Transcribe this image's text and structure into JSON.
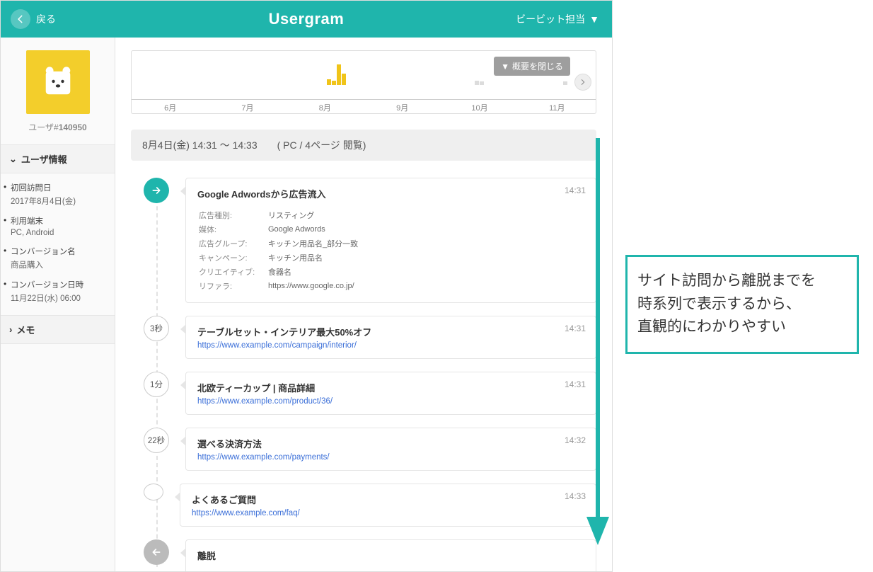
{
  "colors": {
    "brand": "#1fb5ac",
    "accentYellow": "#f0c419"
  },
  "header": {
    "back_label": "戻る",
    "app_title": "Usergram",
    "account_label": "ビービット担当"
  },
  "sidebar": {
    "user_id_prefix": "ユーザ#",
    "user_id": "140950",
    "user_info_title": "ユーザ情報",
    "memo_title": "メモ",
    "items": [
      {
        "label": "初回訪問日",
        "value": "2017年8月4日(金)"
      },
      {
        "label": "利用端末",
        "value": "PC, Android"
      },
      {
        "label": "コンバージョン名",
        "value": "商品購入"
      },
      {
        "label": "コンバージョン日時",
        "value": "11月22日(水) 06:00"
      }
    ]
  },
  "chart_data": {
    "type": "bar",
    "title": "",
    "xlabel": "",
    "ylabel": "",
    "categories": [
      "6月",
      "7月",
      "8月",
      "9月",
      "10月",
      "11月"
    ],
    "series": [
      {
        "name": "activity",
        "color": "#f0c419",
        "bars": [
          {
            "x_pct": 42.0,
            "h_pct": 14
          },
          {
            "x_pct": 43.2,
            "h_pct": 10
          },
          {
            "x_pct": 44.2,
            "h_pct": 48
          },
          {
            "x_pct": 45.2,
            "h_pct": 26
          }
        ]
      },
      {
        "name": "ghost",
        "color": "#dcdcdc",
        "bars": [
          {
            "x_pct": 74.0,
            "h_pct": 10
          },
          {
            "x_pct": 75.0,
            "h_pct": 8
          },
          {
            "x_pct": 93.0,
            "h_pct": 8
          }
        ]
      }
    ],
    "close_button_label": "概要を閉じる"
  },
  "session": {
    "headline": "8月4日(金) 14:31 ～ 14:33　　( PC / 4ページ 閲覧)"
  },
  "timeline": [
    {
      "kind": "entry",
      "title": "Google Adwordsから広告流入",
      "time": "14:31",
      "details": [
        {
          "k": "広告種別:",
          "v": "リスティング"
        },
        {
          "k": "媒体:",
          "v": "Google Adwords"
        },
        {
          "k": "広告グループ:",
          "v": "キッチン用品名_部分一致"
        },
        {
          "k": "キャンペーン:",
          "v": "キッチン用品名"
        },
        {
          "k": "クリエイティブ:",
          "v": "食器名"
        },
        {
          "k": "リファラ:",
          "v": "https://www.google.co.jp/"
        }
      ]
    },
    {
      "kind": "page",
      "duration": "3秒",
      "title": "テーブルセット・インテリア最大50%オフ",
      "url": "https://www.example.com/campaign/interior/",
      "time": "14:31"
    },
    {
      "kind": "page",
      "duration": "1分",
      "title": "北欧ティーカップ | 商品詳細",
      "url": "https://www.example.com/product/36/",
      "time": "14:31"
    },
    {
      "kind": "page",
      "duration": "22秒",
      "title": "選べる決済方法",
      "url": "https://www.example.com/payments/",
      "time": "14:32"
    },
    {
      "kind": "page",
      "duration": "",
      "title": "よくあるご質問",
      "url": "https://www.example.com/faq/",
      "time": "14:33"
    },
    {
      "kind": "exit",
      "title": "離脱"
    }
  ],
  "callout": {
    "text": "サイト訪問から離脱までを\n時系列で表示するから、\n直観的にわかりやすい"
  }
}
